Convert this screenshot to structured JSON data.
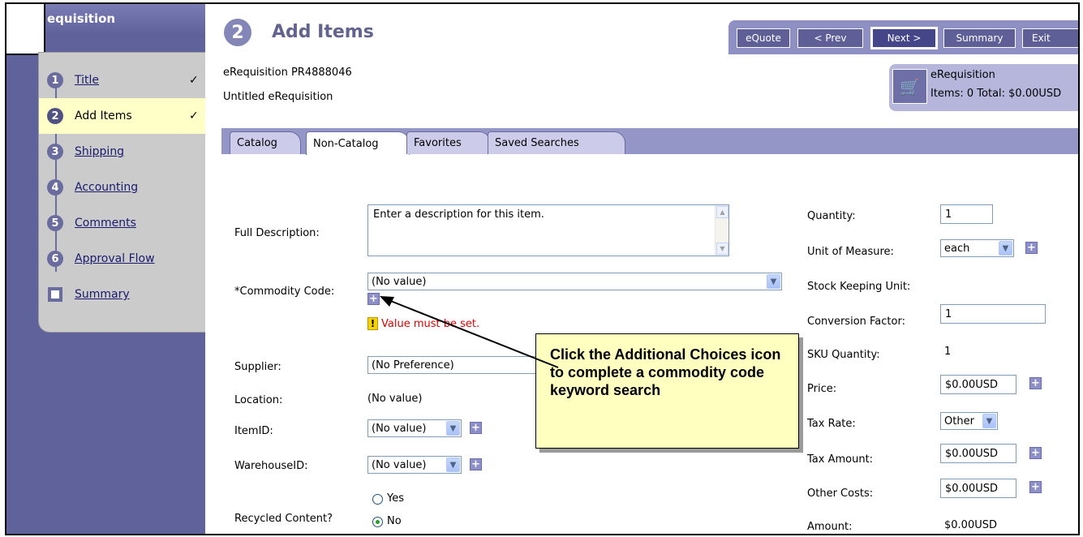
{
  "nav": {
    "title": "equisition",
    "steps": [
      {
        "num": "1",
        "label": "Title",
        "check": "✓"
      },
      {
        "num": "2",
        "label": "Add Items",
        "check": "✓"
      },
      {
        "num": "3",
        "label": "Shipping"
      },
      {
        "num": "4",
        "label": "Accounting"
      },
      {
        "num": "5",
        "label": "Comments"
      },
      {
        "num": "6",
        "label": "Approval Flow"
      },
      {
        "label": "Summary"
      }
    ]
  },
  "header": {
    "step_num": "2",
    "title": "Add Items",
    "buttons": {
      "equote": "eQuote",
      "prev": "< Prev",
      "next": "Next >",
      "summary": "Summary",
      "exit": "Exit"
    }
  },
  "requisition": {
    "id": "eRequisition PR4888046",
    "name": "Untitled eRequisition"
  },
  "cart": {
    "title": "eRequisition",
    "summary": "Items: 0  Total: $0.00USD"
  },
  "tabs": [
    {
      "label": "Catalog"
    },
    {
      "label": "Non-Catalog",
      "active": true
    },
    {
      "label": "Favorites"
    },
    {
      "label": "Saved Searches"
    }
  ],
  "form_left": {
    "full_description": {
      "label": "Full Description:",
      "value": "Enter a description for this item."
    },
    "commodity_code": {
      "label": "*Commodity Code:",
      "value": "(No value)",
      "error": "Value must be set."
    },
    "supplier": {
      "label": "Supplier:",
      "value": "(No Preference)"
    },
    "location": {
      "label": "Location:",
      "value": "(No value)"
    },
    "item_id": {
      "label": "ItemID:",
      "value": "(No value)"
    },
    "warehouse_id": {
      "label": "WarehouseID:",
      "value": "(No value)"
    },
    "recycled": {
      "label": "Recycled Content?",
      "options": [
        "Yes",
        "No"
      ],
      "selected": "No"
    }
  },
  "form_right": {
    "quantity": {
      "label": "Quantity:",
      "value": "1"
    },
    "uom": {
      "label": "Unit of Measure:",
      "value": "each"
    },
    "sku": {
      "label": "Stock Keeping Unit:"
    },
    "conversion": {
      "label": "Conversion Factor:",
      "value": "1"
    },
    "sku_qty": {
      "label": "SKU Quantity:",
      "value": "1"
    },
    "price": {
      "label": "Price:",
      "value": "$0.00USD"
    },
    "tax_rate": {
      "label": "Tax Rate:",
      "value": "Other"
    },
    "tax_amount": {
      "label": "Tax Amount:",
      "value": "$0.00USD"
    },
    "other_costs": {
      "label": "Other Costs:",
      "value": "$0.00USD"
    },
    "amount": {
      "label": "Amount:",
      "value": "$0.00USD"
    }
  },
  "callout": {
    "text": "Click the Additional Choices icon to complete a commodity code keyword search"
  }
}
